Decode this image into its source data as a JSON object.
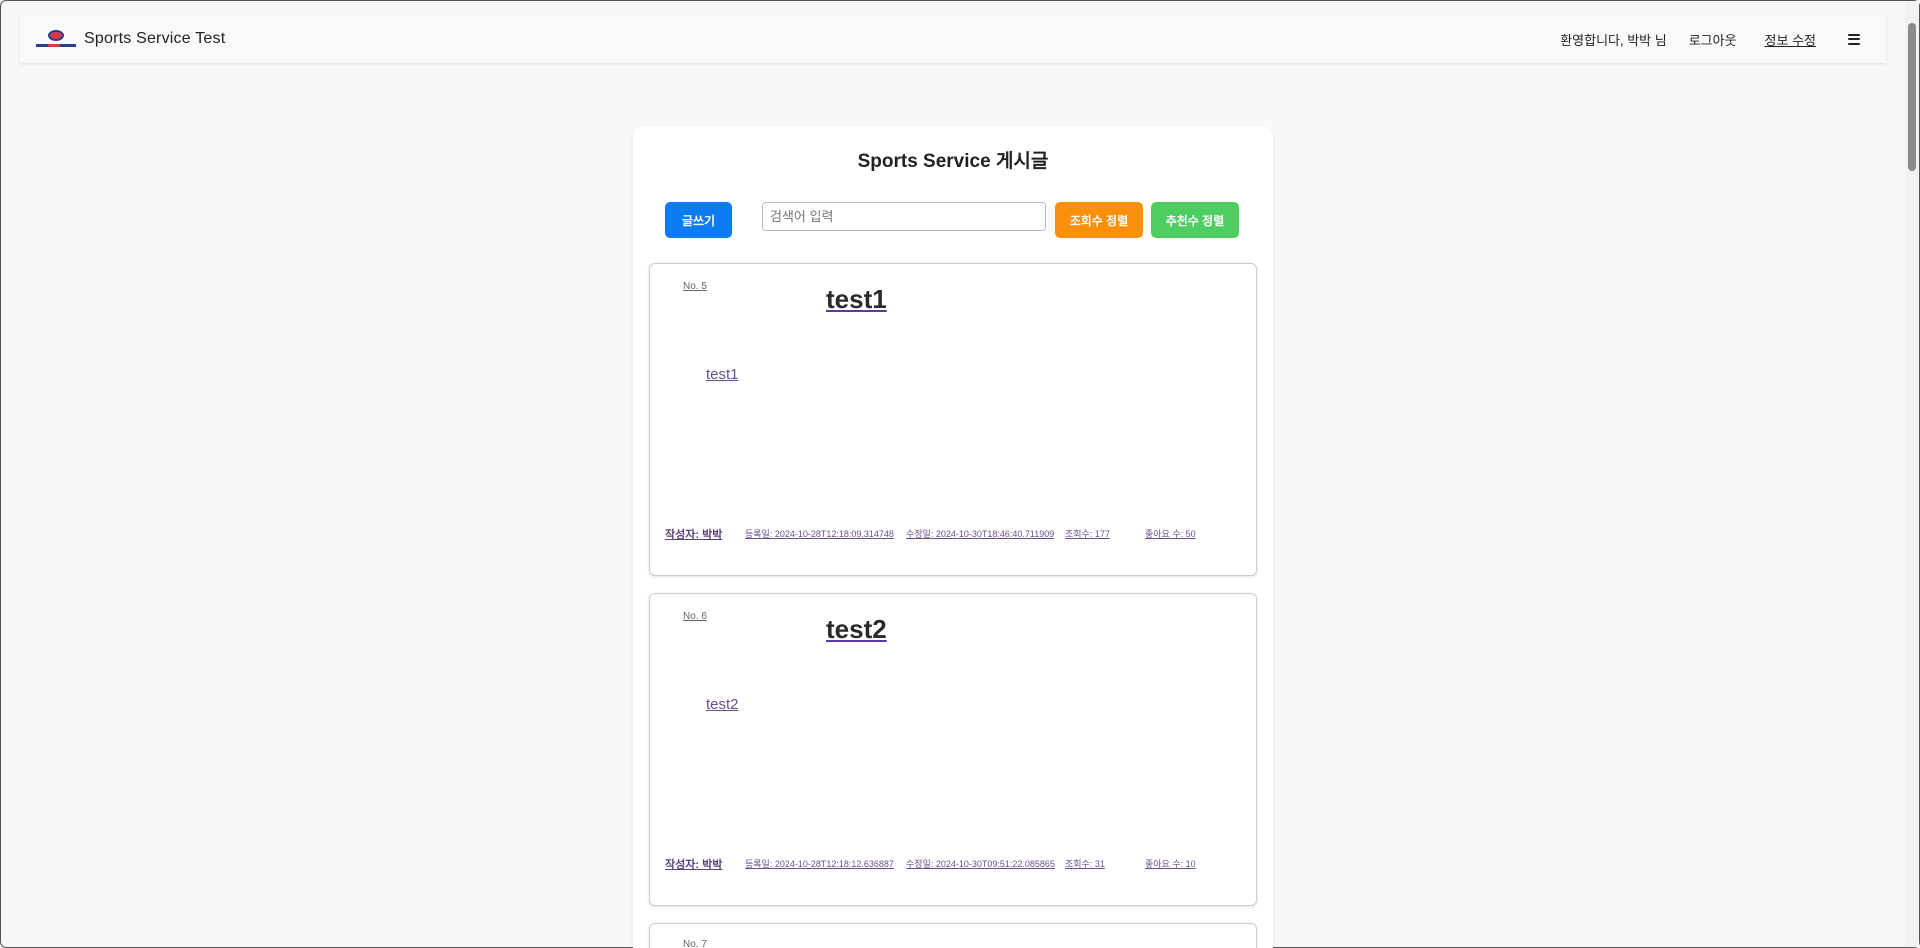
{
  "header": {
    "brand_title": "Sports Service Test",
    "welcome": "환영합니다, 박박 님",
    "logout_label": "로그아웃",
    "edit_info_label": "정보 수정"
  },
  "board": {
    "title": "Sports Service 게시글",
    "write_label": "글쓰기",
    "search_placeholder": "검색어 입력",
    "sort_views_label": "조회수 정렬",
    "sort_likes_label": "추천수 정렬",
    "posts": [
      {
        "no": "No. 5",
        "title": "test1",
        "content": "test1",
        "author": "작성자: 박박",
        "created": "등록일: 2024-10-28T12:18:09.314748",
        "updated": "수정일: 2024-10-30T18:46:40.711909",
        "views": "조회수: 177",
        "likes": "좋아요 수: 50"
      },
      {
        "no": "No. 6",
        "title": "test2",
        "content": "test2",
        "author": "작성자: 박박",
        "created": "등록일: 2024-10-28T12:18:12.636887",
        "updated": "수정일: 2024-10-30T09:51:22.085865",
        "views": "조회수: 31",
        "likes": "좋아요 수: 10"
      },
      {
        "no": "No. 7"
      }
    ]
  },
  "colors": {
    "primary": "#0d7cf2",
    "orange": "#fa8f0c",
    "green": "#4ecd63"
  }
}
